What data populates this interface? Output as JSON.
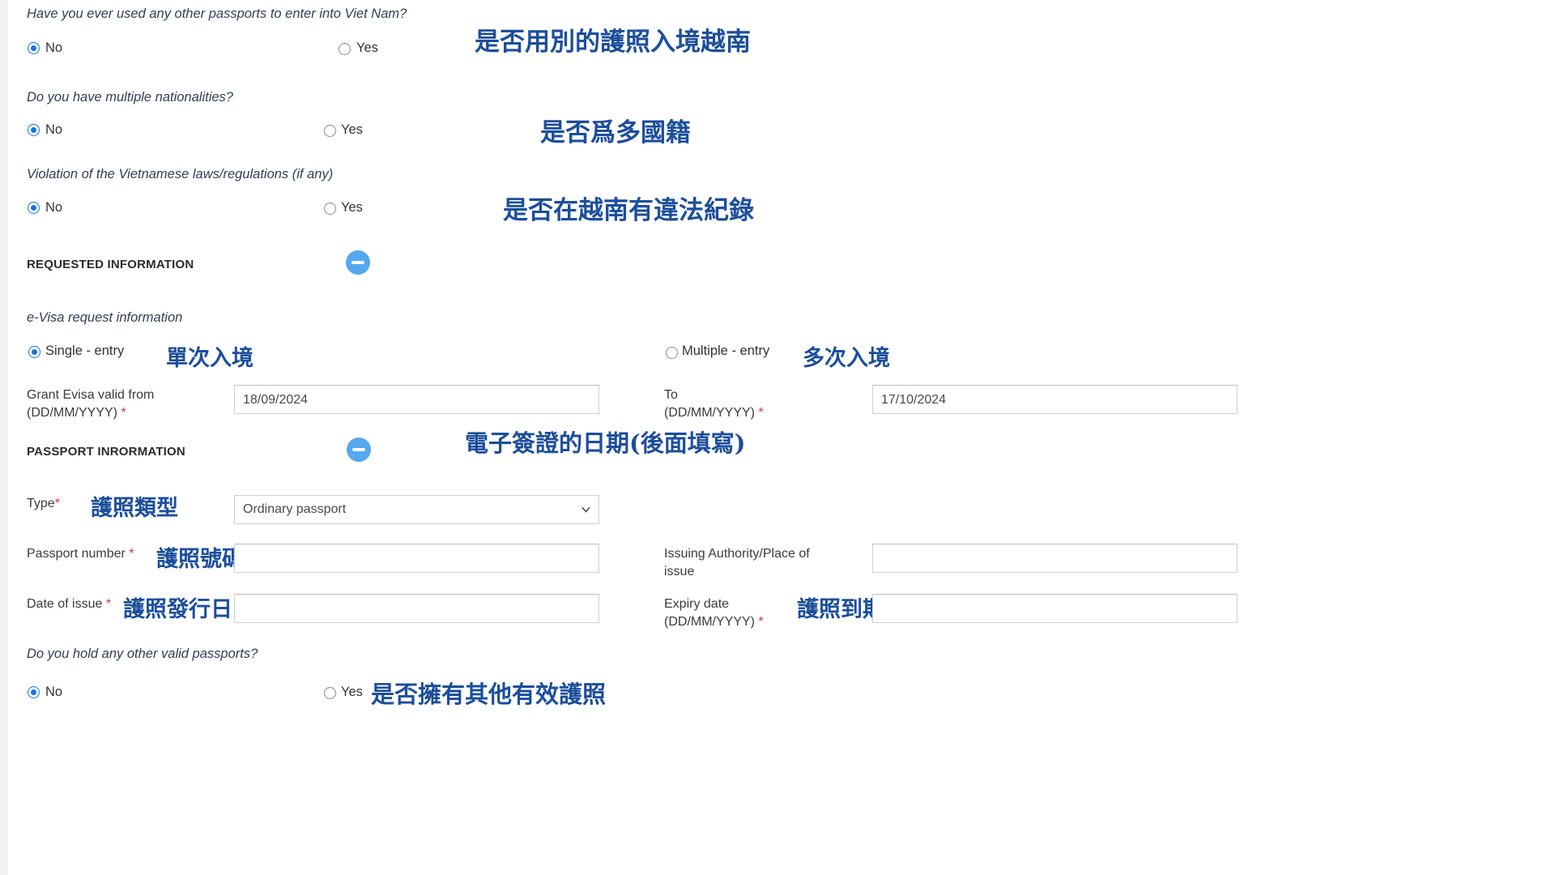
{
  "form": {
    "questions": {
      "other_passports": {
        "label": "Have you ever used any other passports to enter into Viet Nam?",
        "no": "No",
        "yes": "Yes",
        "selected": "No",
        "annotation": "是否用別的護照入境越南"
      },
      "multiple_nationalities": {
        "label": "Do you have multiple nationalities?",
        "no": "No",
        "yes": "Yes",
        "selected": "No",
        "annotation": "是否爲多國籍"
      },
      "law_violation": {
        "label": "Violation of the Vietnamese laws/regulations (if any)",
        "no": "No",
        "yes": "Yes",
        "selected": "No",
        "annotation": "是否在越南有違法紀錄"
      },
      "other_valid_passports": {
        "label": "Do you hold any other valid passports?",
        "no": "No",
        "yes": "Yes",
        "selected": "No",
        "annotation": "是否擁有其他有效護照"
      }
    },
    "requested_information": {
      "heading": "REQUESTED INFORMATION",
      "subheading": "e-Visa request information",
      "entry_type": {
        "single": "Single - entry",
        "multiple": "Multiple - entry",
        "selected": "Single - entry",
        "single_annotation": "單次入境",
        "multiple_annotation": "多次入境"
      },
      "valid_from": {
        "label_line1": "Grant Evisa valid from",
        "label_line2": "(DD/MM/YYYY)",
        "required_mark": "*",
        "value": "18/09/2024"
      },
      "valid_to": {
        "label_line1": "To",
        "label_line2": "(DD/MM/YYYY)",
        "required_mark": "*",
        "value": "17/10/2024"
      },
      "dates_annotation": "電子簽證的日期(後面填寫)"
    },
    "passport_information": {
      "heading": "PASSPORT INRORMATION",
      "type": {
        "label": "Type",
        "required_mark": "*",
        "value": "Ordinary passport",
        "annotation": "護照類型"
      },
      "passport_number": {
        "label": "Passport number",
        "required_mark": "*",
        "value": "",
        "annotation": "護照號碼"
      },
      "issuing_authority": {
        "label_line1": "Issuing Authority/Place of",
        "label_line2": "issue",
        "value": ""
      },
      "date_of_issue": {
        "label": "Date of issue",
        "required_mark": "*",
        "value": "",
        "annotation": "護照發行日"
      },
      "expiry_date": {
        "label_line1": "Expiry date",
        "label_line2": "(DD/MM/YYYY)",
        "required_mark": "*",
        "value": "",
        "annotation": "護照到期日"
      }
    }
  },
  "colors": {
    "accent_blue": "#1673e6",
    "annotation_blue": "#1c4e9c",
    "required_red": "#e03131",
    "collapse_icon": "#55a8ef"
  }
}
